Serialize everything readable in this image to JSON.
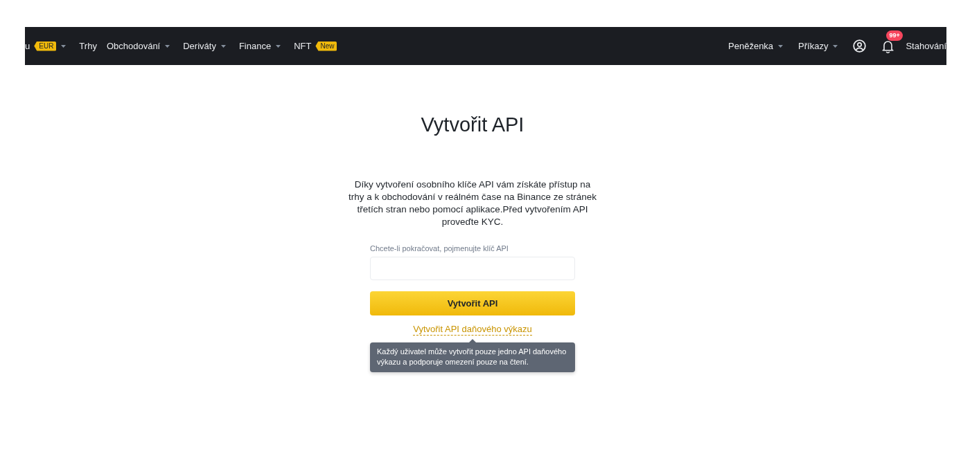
{
  "navbar": {
    "left_items": [
      {
        "label": "u",
        "badge": "EUR",
        "dropdown": true
      },
      {
        "label": "Trhy",
        "dropdown": false
      },
      {
        "label": "Obchodování",
        "dropdown": true
      },
      {
        "label": "Deriváty",
        "dropdown": true
      },
      {
        "label": "Finance",
        "dropdown": true
      },
      {
        "label": "NFT",
        "badge": "New",
        "dropdown": false
      }
    ],
    "right_items": [
      {
        "kind": "menu",
        "label": "Peněženka",
        "dropdown": true
      },
      {
        "kind": "menu",
        "label": "Příkazy",
        "dropdown": true
      },
      {
        "kind": "account"
      },
      {
        "kind": "notifications",
        "badge": "99+"
      },
      {
        "kind": "menu",
        "label": "Stahování",
        "dropdown": false
      }
    ]
  },
  "main": {
    "title": "Vytvořit API",
    "description": "Díky vytvoření osobního klíče API vám získáte přístup na trhy a k obchodování v reálném čase na Binance ze stránek třetích stran nebo pomocí aplikace.Před vytvořením API proveďte KYC.",
    "field": {
      "label": "Chcete-li pokračovat, pojmenujte klíč API"
    },
    "submit_button": "Vytvořit API",
    "link": "Vytvořit API daňového výkazu",
    "tooltip": "Každý uživatel může vytvořit pouze jedno API daňového výkazu a podporuje omezení pouze na čtení."
  }
}
